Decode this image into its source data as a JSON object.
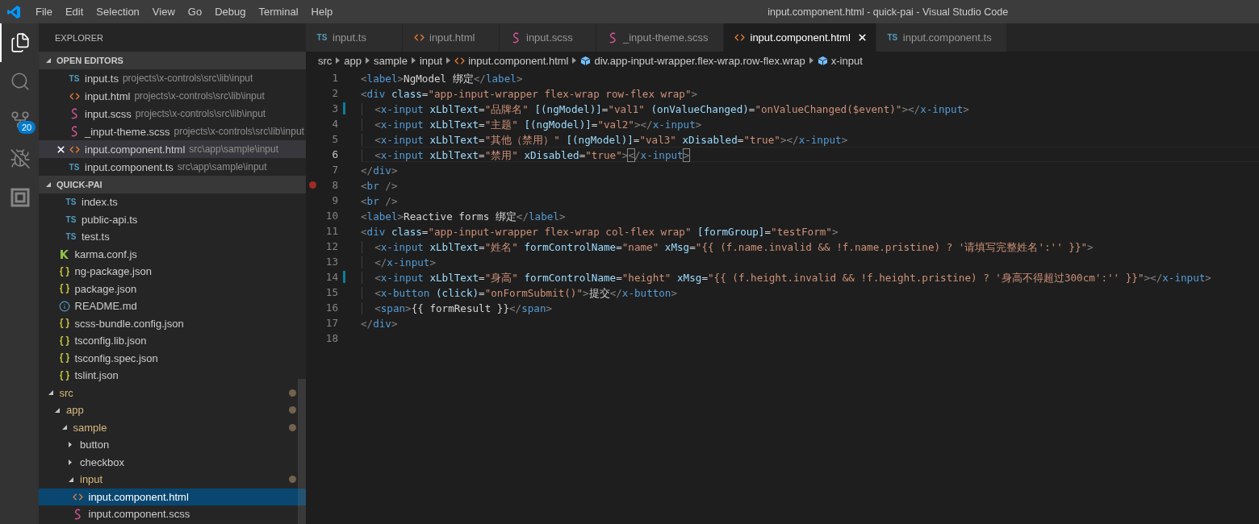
{
  "window": {
    "title": "input.component.html - quick-pai - Visual Studio Code"
  },
  "menu": [
    "File",
    "Edit",
    "Selection",
    "View",
    "Go",
    "Debug",
    "Terminal",
    "Help"
  ],
  "activity_bar": [
    {
      "kind": "explorer",
      "selected": true
    },
    {
      "kind": "search",
      "selected": false
    },
    {
      "kind": "source-control",
      "selected": false,
      "badge": "20"
    },
    {
      "kind": "debug",
      "selected": false
    },
    {
      "kind": "extensions",
      "selected": false
    }
  ],
  "sidebar": {
    "title": "EXPLORER",
    "open_editors": {
      "title": "OPEN EDITORS",
      "expanded": true,
      "items": [
        {
          "kind": "ts",
          "icon_text": "TS",
          "name": "input.ts",
          "path": "projects\\x-controls\\src\\lib\\input",
          "selected": false
        },
        {
          "kind": "html",
          "name": "input.html",
          "path": "projects\\x-controls\\src\\lib\\input",
          "selected": false
        },
        {
          "kind": "scss",
          "name": "input.scss",
          "path": "projects\\x-controls\\src\\lib\\input",
          "selected": false
        },
        {
          "kind": "scss",
          "name": "_input-theme.scss",
          "path": "projects\\x-controls\\src\\lib\\input",
          "selected": false
        },
        {
          "kind": "html",
          "name": "input.component.html",
          "path": "src\\app\\sample\\input",
          "selected": true
        },
        {
          "kind": "ts",
          "icon_text": "TS",
          "name": "input.component.ts",
          "path": "src\\app\\sample\\input",
          "selected": false
        }
      ]
    },
    "project": {
      "title": "QUICK-PAI",
      "expanded": true,
      "tree": [
        {
          "children": [
            {
              "children": [
                {
                  "children": [
                    {
                      "kind": "ts",
                      "icon_text": "TS",
                      "name": "index.ts",
                      "selected": false
                    },
                    {
                      "kind": "ts",
                      "icon_text": "TS",
                      "name": "public-api.ts",
                      "selected": false
                    },
                    {
                      "kind": "ts",
                      "icon_text": "TS",
                      "name": "test.ts",
                      "selected": false
                    }
                  ]
                },
                {
                  "kind": "karma",
                  "name": "karma.conf.js",
                  "selected": false
                },
                {
                  "kind": "json",
                  "name": "ng-package.json",
                  "selected": false
                },
                {
                  "kind": "json",
                  "name": "package.json",
                  "selected": false
                },
                {
                  "kind": "info",
                  "name": "README.md",
                  "selected": false
                },
                {
                  "kind": "json",
                  "name": "scss-bundle.config.json",
                  "selected": false
                },
                {
                  "kind": "json",
                  "name": "tsconfig.lib.json",
                  "selected": false
                },
                {
                  "kind": "json",
                  "name": "tsconfig.spec.json",
                  "selected": false
                },
                {
                  "kind": "json",
                  "name": "tslint.json",
                  "selected": false
                }
              ]
            }
          ]
        },
        {
          "kind": "folder",
          "name": "src",
          "expanded": true,
          "modified": true,
          "children": [
            {
              "kind": "folder",
              "name": "app",
              "expanded": true,
              "modified": true,
              "children": [
                {
                  "kind": "folder",
                  "name": "sample",
                  "expanded": true,
                  "modified": true,
                  "children": [
                    {
                      "kind": "folder",
                      "name": "button",
                      "expanded": false,
                      "modified": false
                    },
                    {
                      "kind": "folder",
                      "name": "checkbox",
                      "expanded": false,
                      "modified": false
                    },
                    {
                      "kind": "folder",
                      "name": "input",
                      "expanded": true,
                      "modified": true,
                      "children": [
                        {
                          "kind": "html",
                          "name": "input.component.html",
                          "selected": true
                        },
                        {
                          "kind": "scss",
                          "name": "input.component.scss",
                          "selected": false
                        }
                      ]
                    }
                  ]
                }
              ]
            }
          ]
        }
      ]
    }
  },
  "tabs": [
    {
      "kind": "ts",
      "icon_text": "TS",
      "label": "input.ts",
      "selected": false
    },
    {
      "kind": "html",
      "label": "input.html",
      "selected": false
    },
    {
      "kind": "scss",
      "label": "input.scss",
      "selected": false
    },
    {
      "kind": "scss",
      "label": "_input-theme.scss",
      "selected": false
    },
    {
      "kind": "html",
      "label": "input.component.html",
      "selected": true
    },
    {
      "kind": "ts",
      "icon_text": "TS",
      "label": "input.component.ts",
      "selected": false
    }
  ],
  "breadcrumbs": [
    {
      "kind": "folder",
      "label": "src"
    },
    {
      "kind": "folder",
      "label": "app"
    },
    {
      "kind": "folder",
      "label": "sample"
    },
    {
      "kind": "folder",
      "label": "input"
    },
    {
      "kind": "html",
      "label": "input.component.html"
    },
    {
      "kind": "symbol",
      "label": "div.app-input-wrapper.flex-wrap.row-flex.wrap"
    },
    {
      "kind": "symbol",
      "label": "x-input"
    }
  ],
  "editor": {
    "lines": [
      {
        "number": "1",
        "tokens": [
          {
            "kind": "bracket",
            "text": "<"
          },
          {
            "kind": "tag",
            "text": "label"
          },
          {
            "kind": "bracket",
            "text": ">"
          },
          {
            "kind": "plain",
            "text": "NgModel 绑定"
          },
          {
            "kind": "bracket",
            "text": "</"
          },
          {
            "kind": "tag",
            "text": "label"
          },
          {
            "kind": "bracket",
            "text": ">"
          }
        ]
      },
      {
        "number": "2",
        "tokens": [
          {
            "kind": "bracket",
            "text": "<"
          },
          {
            "kind": "tag",
            "text": "div"
          },
          {
            "kind": "attribute",
            "text": " class"
          },
          {
            "kind": "plain",
            "text": "="
          },
          {
            "kind": "string",
            "text": "\"app-input-wrapper flex-wrap row-flex wrap\""
          },
          {
            "kind": "bracket",
            "text": ">"
          }
        ]
      },
      {
        "number": "3",
        "indented": true,
        "modified": true,
        "tokens": [
          {
            "kind": "bracket",
            "text": "<"
          },
          {
            "kind": "tag",
            "text": "x-input"
          },
          {
            "kind": "attribute",
            "text": " xLblText"
          },
          {
            "kind": "plain",
            "text": "="
          },
          {
            "kind": "string",
            "text": "\"品牌名\""
          },
          {
            "kind": "attribute",
            "text": " [(ngModel)]"
          },
          {
            "kind": "plain",
            "text": "="
          },
          {
            "kind": "string",
            "text": "\"val1\""
          },
          {
            "kind": "attribute",
            "text": " (onValueChanged)"
          },
          {
            "kind": "plain",
            "text": "="
          },
          {
            "kind": "string",
            "text": "\"onValueChanged($event)\""
          },
          {
            "kind": "bracket",
            "text": "></"
          },
          {
            "kind": "tag",
            "text": "x-input"
          },
          {
            "kind": "bracket",
            "text": ">"
          }
        ]
      },
      {
        "number": "4",
        "indented": true,
        "tokens": [
          {
            "kind": "bracket",
            "text": "<"
          },
          {
            "kind": "tag",
            "text": "x-input"
          },
          {
            "kind": "attribute",
            "text": " xLblText"
          },
          {
            "kind": "plain",
            "text": "="
          },
          {
            "kind": "string",
            "text": "\"主题\""
          },
          {
            "kind": "attribute",
            "text": " [(ngModel)]"
          },
          {
            "kind": "plain",
            "text": "="
          },
          {
            "kind": "string",
            "text": "\"val2\""
          },
          {
            "kind": "bracket",
            "text": "></"
          },
          {
            "kind": "tag",
            "text": "x-input"
          },
          {
            "kind": "bracket",
            "text": ">"
          }
        ]
      },
      {
        "number": "5",
        "indented": true,
        "tokens": [
          {
            "kind": "bracket",
            "text": "<"
          },
          {
            "kind": "tag",
            "text": "x-input"
          },
          {
            "kind": "attribute",
            "text": " xLblText"
          },
          {
            "kind": "plain",
            "text": "="
          },
          {
            "kind": "string",
            "text": "\"其他（禁用）\""
          },
          {
            "kind": "attribute",
            "text": " [(ngModel)]"
          },
          {
            "kind": "plain",
            "text": "="
          },
          {
            "kind": "string",
            "text": "\"val3\""
          },
          {
            "kind": "attribute",
            "text": " xDisabled"
          },
          {
            "kind": "plain",
            "text": "="
          },
          {
            "kind": "string",
            "text": "\"true\""
          },
          {
            "kind": "bracket",
            "text": "></"
          },
          {
            "kind": "tag",
            "text": "x-input"
          },
          {
            "kind": "bracket",
            "text": ">"
          }
        ]
      },
      {
        "number": "6",
        "indented": true,
        "current": true,
        "tokens": [
          {
            "kind": "bracket",
            "text": "<"
          },
          {
            "kind": "tag",
            "text": "x-input"
          },
          {
            "kind": "attribute",
            "text": " xLblText"
          },
          {
            "kind": "plain",
            "text": "="
          },
          {
            "kind": "string",
            "text": "\"禁用\""
          },
          {
            "kind": "attribute",
            "text": " xDisabled"
          },
          {
            "kind": "plain",
            "text": "="
          },
          {
            "kind": "string",
            "text": "\"true\""
          },
          {
            "kind": "bracket",
            "text": ">"
          },
          {
            "kind": "matched-bracket",
            "text": "<"
          },
          {
            "kind": "bracket",
            "text": "/"
          },
          {
            "kind": "tag",
            "text": "x-input"
          },
          {
            "kind": "matched-bracket",
            "text": ">"
          }
        ]
      },
      {
        "number": "7",
        "tokens": [
          {
            "kind": "bracket",
            "text": "</"
          },
          {
            "kind": "tag",
            "text": "div"
          },
          {
            "kind": "bracket",
            "text": ">"
          }
        ]
      },
      {
        "number": "8",
        "breakpoint": true,
        "tokens": [
          {
            "kind": "bracket",
            "text": "<"
          },
          {
            "kind": "tag",
            "text": "br"
          },
          {
            "kind": "bracket",
            "text": " />"
          }
        ]
      },
      {
        "number": "9",
        "tokens": [
          {
            "kind": "bracket",
            "text": "<"
          },
          {
            "kind": "tag",
            "text": "br"
          },
          {
            "kind": "bracket",
            "text": " />"
          }
        ]
      },
      {
        "number": "10",
        "tokens": [
          {
            "kind": "bracket",
            "text": "<"
          },
          {
            "kind": "tag",
            "text": "label"
          },
          {
            "kind": "bracket",
            "text": ">"
          },
          {
            "kind": "plain",
            "text": "Reactive forms 绑定"
          },
          {
            "kind": "bracket",
            "text": "</"
          },
          {
            "kind": "tag",
            "text": "label"
          },
          {
            "kind": "bracket",
            "text": ">"
          }
        ]
      },
      {
        "number": "11",
        "tokens": [
          {
            "kind": "bracket",
            "text": "<"
          },
          {
            "kind": "tag",
            "text": "div"
          },
          {
            "kind": "attribute",
            "text": " class"
          },
          {
            "kind": "plain",
            "text": "="
          },
          {
            "kind": "string",
            "text": "\"app-input-wrapper flex-wrap col-flex wrap\""
          },
          {
            "kind": "attribute",
            "text": " [formGroup]"
          },
          {
            "kind": "plain",
            "text": "="
          },
          {
            "kind": "string",
            "text": "\"testForm\""
          },
          {
            "kind": "bracket",
            "text": ">"
          }
        ]
      },
      {
        "number": "12",
        "indented": true,
        "tokens": [
          {
            "kind": "bracket",
            "text": "<"
          },
          {
            "kind": "tag",
            "text": "x-input"
          },
          {
            "kind": "attribute",
            "text": " xLblText"
          },
          {
            "kind": "plain",
            "text": "="
          },
          {
            "kind": "string",
            "text": "\"姓名\""
          },
          {
            "kind": "attribute",
            "text": " formControlName"
          },
          {
            "kind": "plain",
            "text": "="
          },
          {
            "kind": "string",
            "text": "\"name\""
          },
          {
            "kind": "attribute",
            "text": " xMsg"
          },
          {
            "kind": "plain",
            "text": "="
          },
          {
            "kind": "string",
            "text": "\"{{ (f.name.invalid && !f.name.pristine) ? '请填写完整姓名':'' }}\""
          },
          {
            "kind": "bracket",
            "text": ">"
          }
        ]
      },
      {
        "number": "13",
        "indented": true,
        "tokens": [
          {
            "kind": "bracket",
            "text": "</"
          },
          {
            "kind": "tag",
            "text": "x-input"
          },
          {
            "kind": "bracket",
            "text": ">"
          }
        ]
      },
      {
        "number": "14",
        "indented": true,
        "modified": true,
        "tokens": [
          {
            "kind": "bracket",
            "text": "<"
          },
          {
            "kind": "tag",
            "text": "x-input"
          },
          {
            "kind": "attribute",
            "text": " xLblText"
          },
          {
            "kind": "plain",
            "text": "="
          },
          {
            "kind": "string",
            "text": "\"身高\""
          },
          {
            "kind": "attribute",
            "text": " formControlName"
          },
          {
            "kind": "plain",
            "text": "="
          },
          {
            "kind": "string",
            "text": "\"height\""
          },
          {
            "kind": "attribute",
            "text": " xMsg"
          },
          {
            "kind": "plain",
            "text": "="
          },
          {
            "kind": "string",
            "text": "\"{{ (f.height.invalid && !f.height.pristine) ? '身高不得超过300cm':'' }}\""
          },
          {
            "kind": "bracket",
            "text": "></"
          },
          {
            "kind": "tag",
            "text": "x-input"
          },
          {
            "kind": "bracket",
            "text": ">"
          }
        ]
      },
      {
        "number": "15",
        "indented": true,
        "tokens": [
          {
            "kind": "bracket",
            "text": "<"
          },
          {
            "kind": "tag",
            "text": "x-button"
          },
          {
            "kind": "attribute",
            "text": " (click)"
          },
          {
            "kind": "plain",
            "text": "="
          },
          {
            "kind": "string",
            "text": "\"onFormSubmit()\""
          },
          {
            "kind": "bracket",
            "text": ">"
          },
          {
            "kind": "plain",
            "text": "提交"
          },
          {
            "kind": "bracket",
            "text": "</"
          },
          {
            "kind": "tag",
            "text": "x-button"
          },
          {
            "kind": "bracket",
            "text": ">"
          }
        ]
      },
      {
        "number": "16",
        "indented": true,
        "tokens": [
          {
            "kind": "bracket",
            "text": "<"
          },
          {
            "kind": "tag",
            "text": "span"
          },
          {
            "kind": "bracket",
            "text": ">"
          },
          {
            "kind": "plain",
            "text": "{{ formResult }}"
          },
          {
            "kind": "bracket",
            "text": "</"
          },
          {
            "kind": "tag",
            "text": "span"
          },
          {
            "kind": "bracket",
            "text": ">"
          }
        ]
      },
      {
        "number": "17",
        "tokens": [
          {
            "kind": "bracket",
            "text": "</"
          },
          {
            "kind": "tag",
            "text": "div"
          },
          {
            "kind": "bracket",
            "text": ">"
          }
        ]
      },
      {
        "number": "18"
      }
    ]
  }
}
